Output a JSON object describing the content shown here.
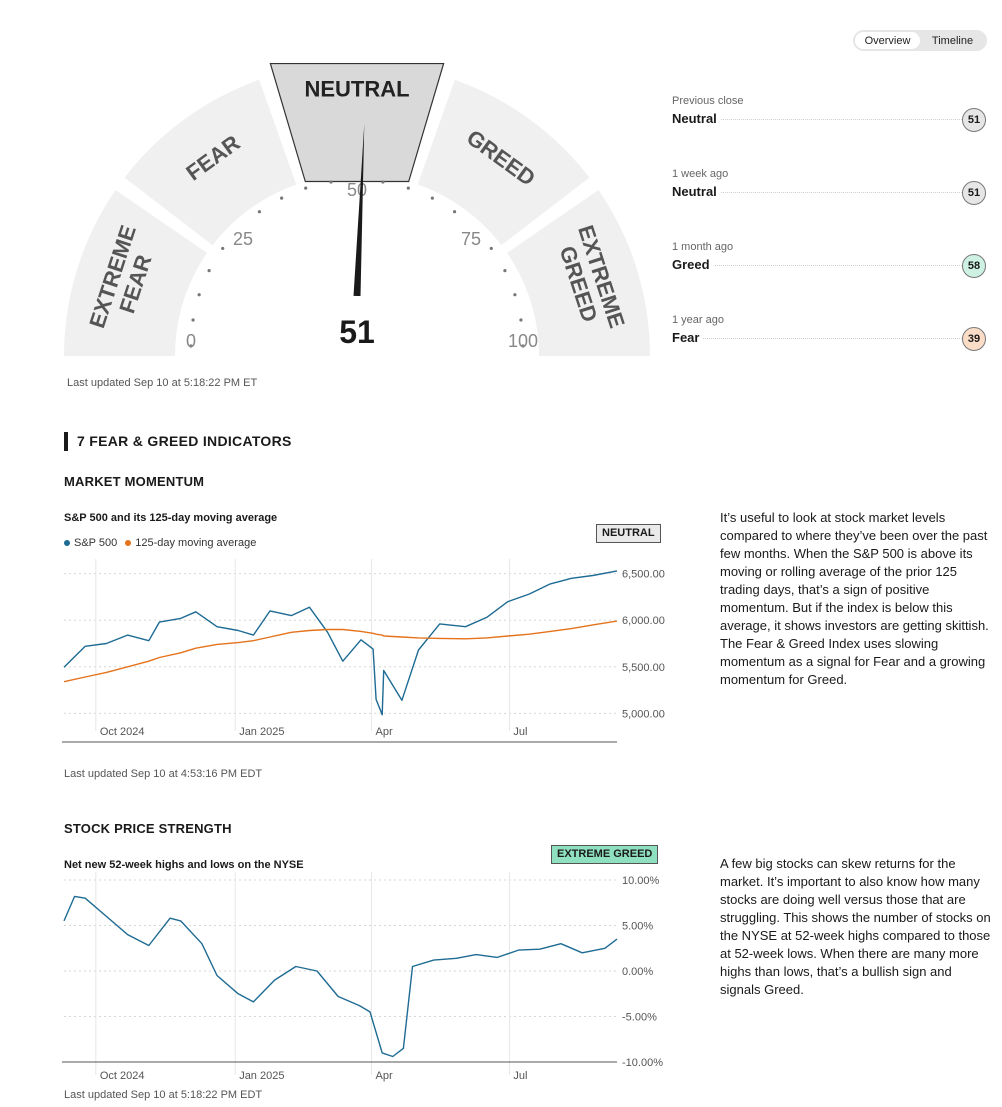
{
  "toggle": {
    "overview": "Overview",
    "timeline": "Timeline"
  },
  "gauge": {
    "value": 51,
    "value_label": "51",
    "segments": [
      {
        "label": "EXTREME\nFEAR",
        "active": false
      },
      {
        "label": "FEAR",
        "active": false
      },
      {
        "label": "NEUTRAL",
        "active": true
      },
      {
        "label": "GREED",
        "active": false
      },
      {
        "label": "EXTREME\nGREED",
        "active": false
      }
    ],
    "ticks": [
      "0",
      "25",
      "50",
      "75",
      "100"
    ],
    "updated": "Last updated Sep 10 at 5:18:22 PM ET",
    "colors": {
      "segment": "#f0f0f0",
      "active": "#d9d9d9",
      "needle": "#1a1a1a"
    }
  },
  "history": [
    {
      "when": "Previous close",
      "label": "Neutral",
      "value": "51",
      "color": "#e6e6e6"
    },
    {
      "when": "1 week ago",
      "label": "Neutral",
      "value": "51",
      "color": "#e6e6e6"
    },
    {
      "when": "1 month ago",
      "label": "Greed",
      "value": "58",
      "color": "#cdf2e3"
    },
    {
      "when": "1 year ago",
      "label": "Fear",
      "value": "39",
      "color": "#fbdcc7"
    }
  ],
  "section_title": "7 FEAR & GREED INDICATORS",
  "momentum": {
    "title": "MARKET MOMENTUM",
    "subtitle": "S&P 500 and its 125-day moving average",
    "legend": [
      {
        "name": "S&P 500",
        "color": "#1e6b93"
      },
      {
        "name": "125-day moving average",
        "color": "#e5731c"
      }
    ],
    "rating": "NEUTRAL",
    "rating_bg": "#eaeaea",
    "updated": "Last updated Sep 10 at 4:53:16 PM EDT",
    "description": "It’s useful to look at stock market levels compared to where they’ve been over the past few months. When the S&P 500 is above its moving or rolling average of the prior 125 trading days, that’s a sign of positive momentum. But if the index is below this average, it shows investors are getting skittish. The Fear & Greed Index uses slowing momentum as a signal for Fear and a growing momentum for Greed."
  },
  "strength": {
    "title": "STOCK PRICE STRENGTH",
    "subtitle": "Net new 52-week highs and lows on the NYSE",
    "rating": "EXTREME GREED",
    "rating_bg": "#8ee0c0",
    "updated": "Last updated Sep 10 at 5:18:22 PM EDT",
    "description": "A few big stocks can skew returns for the market. It’s important to also know how many stocks are doing well versus those that are struggling. This shows the number of stocks on the NYSE at 52-week highs compared to those at 52-week lows. When there are many more highs than lows, that’s a bullish sign and signals Greed."
  },
  "chart_data": [
    {
      "type": "line",
      "title": "S&P 500 and its 125-day moving average",
      "x_ticks": [
        "Oct 2024",
        "Jan 2025",
        "Apr",
        "Jul"
      ],
      "x": [
        "2024-09-10",
        "2024-09-24",
        "2024-10-08",
        "2024-10-22",
        "2024-11-05",
        "2024-11-12",
        "2024-11-26",
        "2024-12-06",
        "2024-12-20",
        "2025-01-03",
        "2025-01-13",
        "2025-01-24",
        "2025-02-07",
        "2025-02-19",
        "2025-03-03",
        "2025-03-13",
        "2025-03-25",
        "2025-04-02",
        "2025-04-04",
        "2025-04-08",
        "2025-04-09",
        "2025-04-21",
        "2025-05-02",
        "2025-05-16",
        "2025-06-02",
        "2025-06-16",
        "2025-06-30",
        "2025-07-14",
        "2025-07-28",
        "2025-08-11",
        "2025-08-25",
        "2025-09-10"
      ],
      "series": [
        {
          "name": "S&P 500",
          "color": "#1e6b93",
          "values": [
            5495,
            5720,
            5750,
            5840,
            5780,
            5980,
            6020,
            6090,
            5930,
            5890,
            5840,
            6100,
            6050,
            6140,
            5870,
            5560,
            5790,
            5690,
            5150,
            4985,
            5460,
            5140,
            5680,
            5960,
            5930,
            6030,
            6200,
            6280,
            6390,
            6450,
            6480,
            6530
          ]
        },
        {
          "name": "125-day moving average",
          "color": "#e5731c",
          "values": [
            5340,
            5390,
            5440,
            5500,
            5560,
            5600,
            5650,
            5700,
            5740,
            5760,
            5780,
            5820,
            5870,
            5890,
            5900,
            5900,
            5880,
            5860,
            5850,
            5840,
            5830,
            5820,
            5810,
            5805,
            5800,
            5810,
            5830,
            5850,
            5880,
            5910,
            5950,
            5990
          ]
        }
      ],
      "y_ticks": [
        "5,000.00",
        "5,500.00",
        "6,000.00",
        "6,500.00"
      ],
      "ylim": [
        4950,
        6550
      ]
    },
    {
      "type": "line",
      "title": "Net new 52-week highs and lows on the NYSE",
      "x_ticks": [
        "Oct 2024",
        "Jan 2025",
        "Apr",
        "Jul"
      ],
      "x": [
        "2024-09-10",
        "2024-09-17",
        "2024-09-24",
        "2024-10-08",
        "2024-10-22",
        "2024-11-05",
        "2024-11-19",
        "2024-11-26",
        "2024-12-10",
        "2024-12-20",
        "2025-01-03",
        "2025-01-13",
        "2025-01-27",
        "2025-02-10",
        "2025-02-24",
        "2025-03-10",
        "2025-03-24",
        "2025-03-31",
        "2025-04-08",
        "2025-04-15",
        "2025-04-22",
        "2025-04-28",
        "2025-05-12",
        "2025-05-27",
        "2025-06-09",
        "2025-06-23",
        "2025-07-07",
        "2025-07-21",
        "2025-08-04",
        "2025-08-18",
        "2025-09-02",
        "2025-09-10"
      ],
      "series": [
        {
          "name": "Net new 52-week highs and lows",
          "color": "#1e6b93",
          "values": [
            5.5,
            8.2,
            8.0,
            6.0,
            4.0,
            2.8,
            5.8,
            5.5,
            3.0,
            -0.5,
            -2.5,
            -3.4,
            -1.0,
            0.5,
            0.0,
            -2.8,
            -3.8,
            -4.5,
            -9.0,
            -9.4,
            -8.5,
            0.5,
            1.2,
            1.4,
            1.8,
            1.5,
            2.3,
            2.4,
            3.0,
            2.0,
            2.5,
            3.5
          ]
        }
      ],
      "y_ticks": [
        "10.00%",
        "5.00%",
        "0.00%",
        "-5.00%",
        "-10.00%"
      ],
      "ylim": [
        -10,
        10
      ]
    }
  ]
}
